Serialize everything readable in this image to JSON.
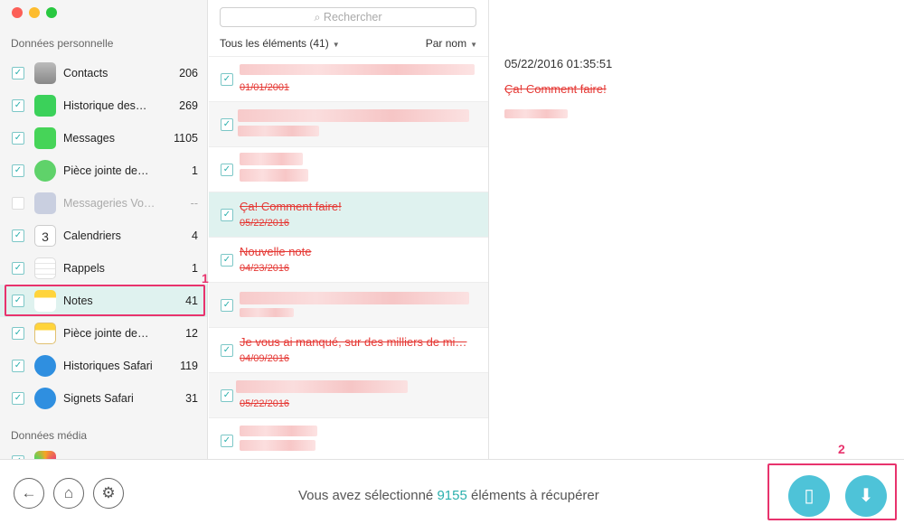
{
  "colors": {
    "accent": "#2bb0ad",
    "highlight": "#e8336d",
    "deleted": "#e53935"
  },
  "sidebar": {
    "section_personal": "Données personnelle",
    "section_media": "Données média",
    "items": [
      {
        "label": "Contacts",
        "count": "206",
        "icon": "contacts-icon"
      },
      {
        "label": "Historique des…",
        "count": "269",
        "icon": "phone-icon"
      },
      {
        "label": "Messages",
        "count": "1105",
        "icon": "messages-icon"
      },
      {
        "label": "Pièce jointe de…",
        "count": "1",
        "icon": "attachment-icon"
      },
      {
        "label": "Messageries Vo…",
        "count": "--",
        "icon": "voicemail-icon"
      },
      {
        "label": "Calendriers",
        "count": "4",
        "icon": "calendar-icon"
      },
      {
        "label": "Rappels",
        "count": "1",
        "icon": "reminders-icon"
      },
      {
        "label": "Notes",
        "count": "41",
        "icon": "notes-icon"
      },
      {
        "label": "Pièce jointe de…",
        "count": "12",
        "icon": "notes-attachment-icon"
      },
      {
        "label": "Historiques Safari",
        "count": "119",
        "icon": "safari-history-icon"
      },
      {
        "label": "Signets Safari",
        "count": "31",
        "icon": "safari-bookmarks-icon"
      }
    ],
    "calendar_day": "3",
    "marker": "1"
  },
  "list": {
    "search_placeholder": "Rechercher",
    "filter_label": "Tous les éléments (41)",
    "sort_label": "Par nom",
    "rows": [
      {
        "title": "",
        "date": "01/01/2001"
      },
      {
        "title": "",
        "date": ""
      },
      {
        "title": "",
        "date": ""
      },
      {
        "title": "Ça! Comment faire!",
        "date": "05/22/2016"
      },
      {
        "title": "Nouvelle note",
        "date": "04/23/2016"
      },
      {
        "title": "",
        "date": ""
      },
      {
        "title": "Je vous ai manqué, sur des milliers de mi…",
        "date": "04/09/2016"
      },
      {
        "title": "",
        "date": "05/22/2016"
      },
      {
        "title": "",
        "date": ""
      }
    ]
  },
  "detail": {
    "date": "05/22/2016 01:35:51",
    "title": "Ça! Comment faire!"
  },
  "bottom": {
    "status_prefix": "Vous avez sélectionné",
    "count": "9155",
    "status_suffix": "éléments à récupérer",
    "marker": "2"
  }
}
